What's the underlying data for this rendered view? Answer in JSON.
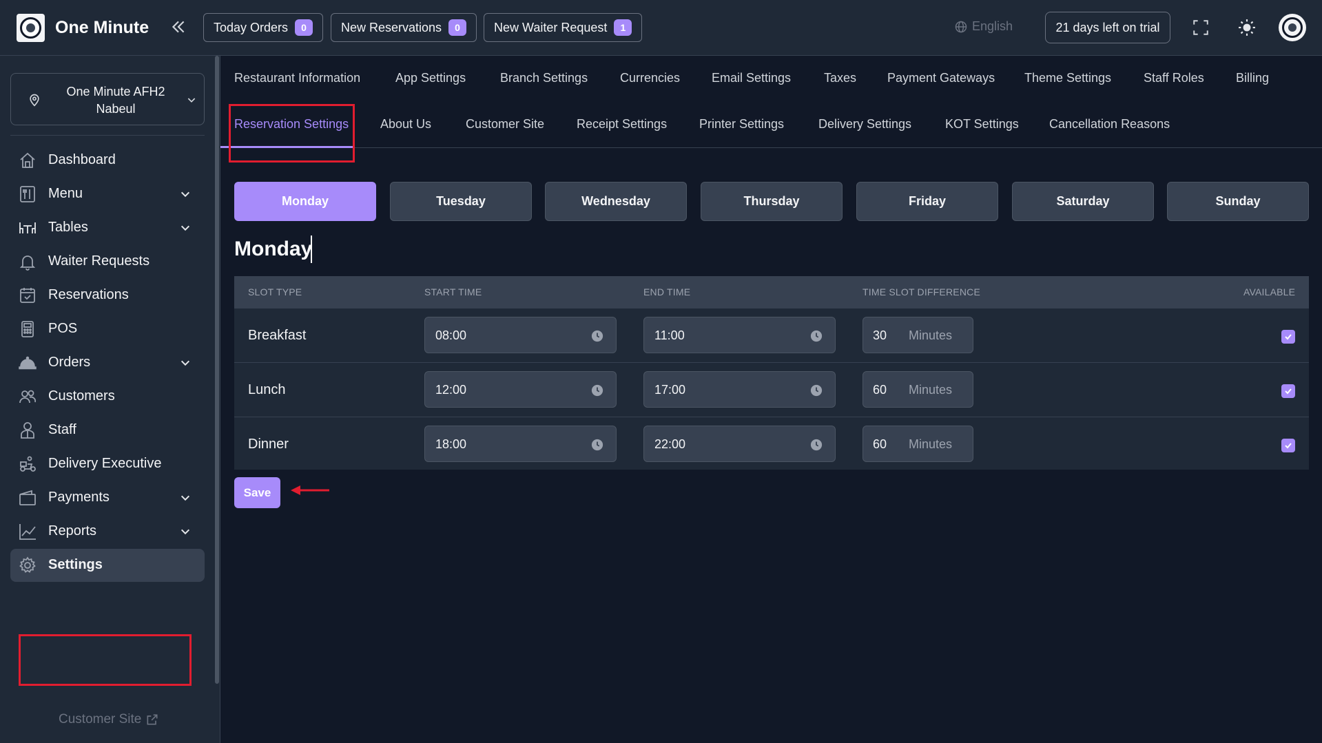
{
  "app": {
    "name": "One Minute"
  },
  "topbar": {
    "today_orders": {
      "label": "Today Orders",
      "count": "0"
    },
    "new_reservations": {
      "label": "New Reservations",
      "count": "0"
    },
    "new_waiter_request": {
      "label": "New Waiter Request",
      "count": "1"
    },
    "language": "English",
    "trial": "21 days left on trial"
  },
  "sidebar": {
    "branch": "One Minute AFH2 Nabeul",
    "items": [
      {
        "label": "Dashboard",
        "icon": "home-icon",
        "expandable": false
      },
      {
        "label": "Menu",
        "icon": "menu-book-icon",
        "expandable": true
      },
      {
        "label": "Tables",
        "icon": "table-icon",
        "expandable": true
      },
      {
        "label": "Waiter Requests",
        "icon": "bell-icon",
        "expandable": false
      },
      {
        "label": "Reservations",
        "icon": "calendar-check-icon",
        "expandable": false
      },
      {
        "label": "POS",
        "icon": "pos-terminal-icon",
        "expandable": false
      },
      {
        "label": "Orders",
        "icon": "cloche-icon",
        "expandable": true
      },
      {
        "label": "Customers",
        "icon": "users-icon",
        "expandable": false
      },
      {
        "label": "Staff",
        "icon": "staff-icon",
        "expandable": false
      },
      {
        "label": "Delivery Executive",
        "icon": "delivery-scooter-icon",
        "expandable": false
      },
      {
        "label": "Payments",
        "icon": "wallet-icon",
        "expandable": true
      },
      {
        "label": "Reports",
        "icon": "chart-line-icon",
        "expandable": true
      },
      {
        "label": "Settings",
        "icon": "gear-icon",
        "expandable": false,
        "active": true
      }
    ],
    "customer_site": "Customer Site"
  },
  "settings_tabs": {
    "row1": [
      "Restaurant Information",
      "App Settings",
      "Branch Settings",
      "Currencies",
      "Email Settings",
      "Taxes",
      "Payment Gateways",
      "Theme Settings",
      "Staff Roles",
      "Billing"
    ],
    "row2": [
      "Reservation Settings",
      "About Us",
      "Customer Site",
      "Receipt Settings",
      "Printer Settings",
      "Delivery Settings",
      "KOT Settings",
      "Cancellation Reasons"
    ],
    "active": "Reservation Settings"
  },
  "days": [
    "Monday",
    "Tuesday",
    "Wednesday",
    "Thursday",
    "Friday",
    "Saturday",
    "Sunday"
  ],
  "active_day": "Monday",
  "table": {
    "headers": {
      "slot_type": "SLOT TYPE",
      "start_time": "START TIME",
      "end_time": "END TIME",
      "time_slot_difference": "TIME SLOT DIFFERENCE",
      "available": "AVAILABLE"
    },
    "rows": [
      {
        "slot": "Breakfast",
        "start": "08:00",
        "end": "11:00",
        "diff": "30",
        "unit": "Minutes",
        "available": true
      },
      {
        "slot": "Lunch",
        "start": "12:00",
        "end": "17:00",
        "diff": "60",
        "unit": "Minutes",
        "available": true
      },
      {
        "slot": "Dinner",
        "start": "18:00",
        "end": "22:00",
        "diff": "60",
        "unit": "Minutes",
        "available": true
      }
    ]
  },
  "save_label": "Save",
  "colors": {
    "accent": "#a78bfa",
    "annotation": "#e11d2f",
    "background": "#111827",
    "panel": "#1f2937"
  }
}
